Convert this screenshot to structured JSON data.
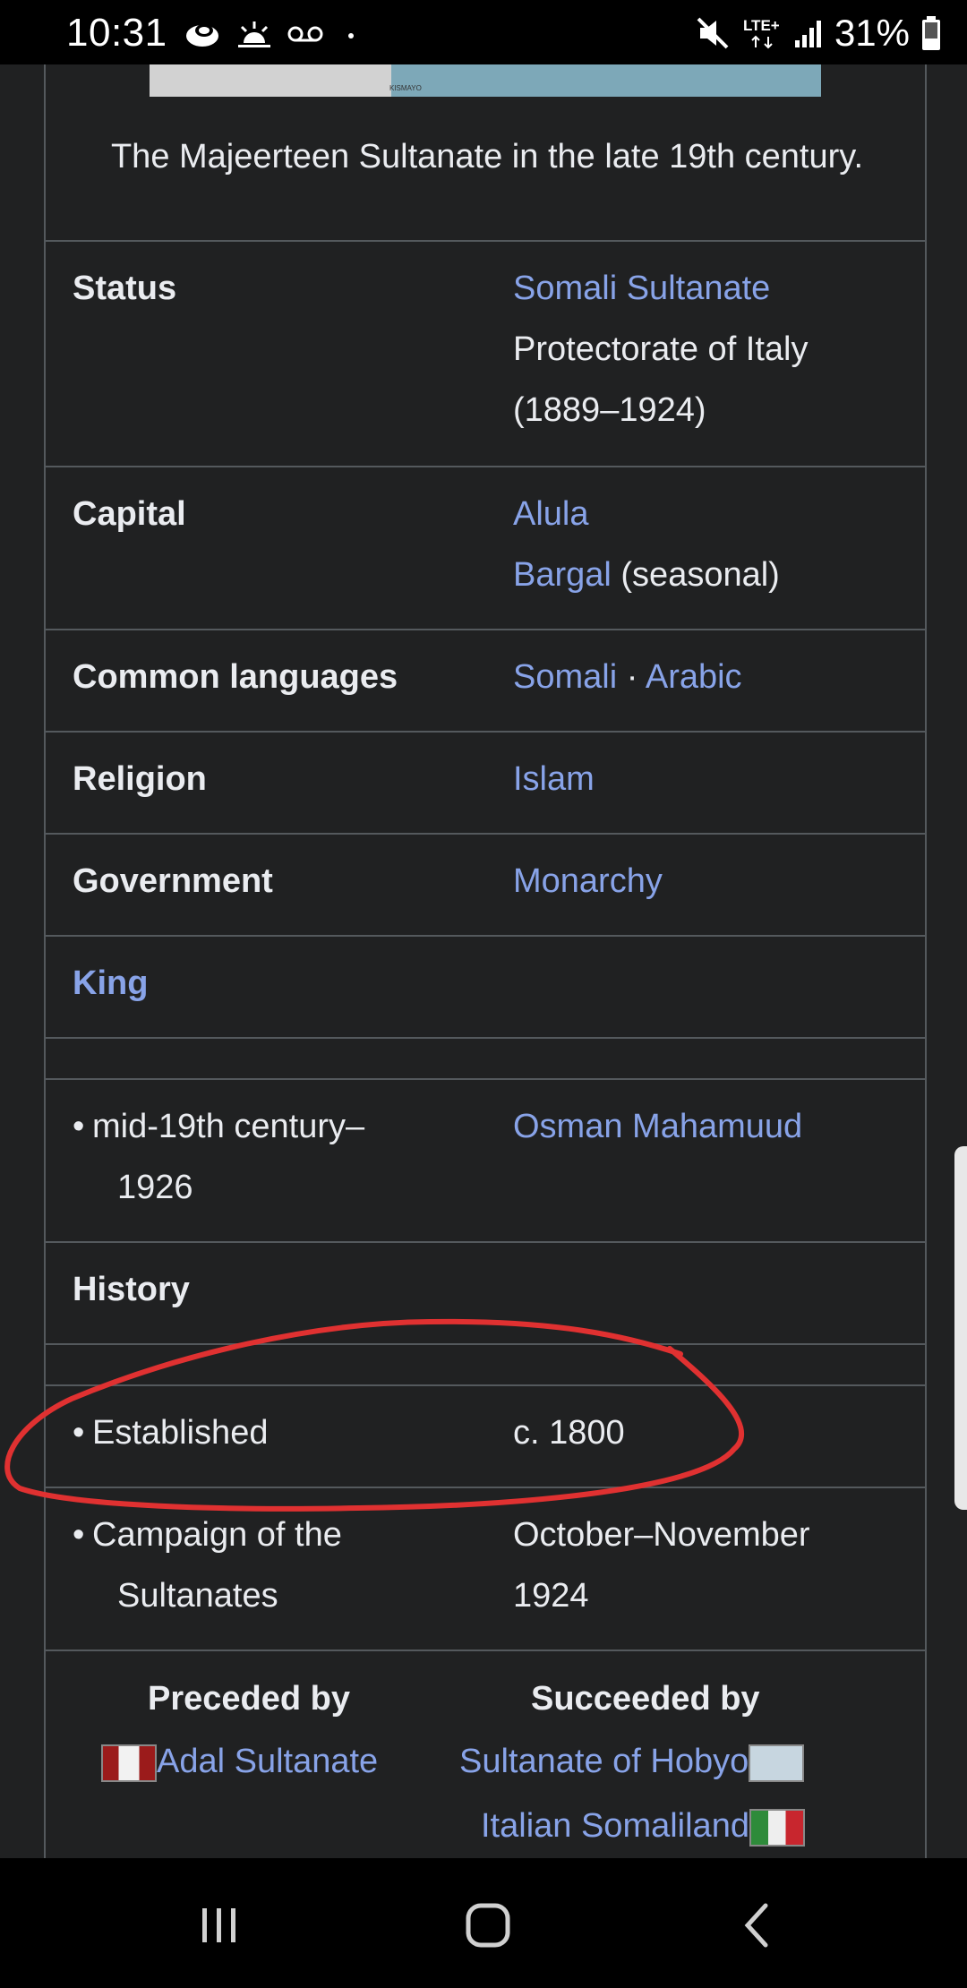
{
  "status_bar": {
    "time": "10:31",
    "left_icons": [
      "cloud-eye-icon",
      "sunrise-icon",
      "voicemail-icon",
      "dot-icon"
    ],
    "network": "LTE+",
    "battery": "31%"
  },
  "infobox": {
    "caption": "The Majeerteen Sultanate in the late 19th century.",
    "map_label": "KISMAYO",
    "rows": [
      {
        "label": "Status",
        "value_link": "Somali Sultanate",
        "value_text": "Protectorate of Italy (1889–1924)"
      },
      {
        "label": "Capital",
        "value_link_1": "Alula",
        "value_link_2": "Bargal",
        "value_text": "(seasonal)"
      },
      {
        "label": "Common languages",
        "value_link_1": "Somali",
        "separator": "·",
        "value_link_2": "Arabic"
      },
      {
        "label": "Religion",
        "value_link": "Islam"
      },
      {
        "label": "Government",
        "value_link": "Monarchy"
      },
      {
        "label": "King"
      },
      {
        "sub_label_1": "mid-19th century–",
        "sub_label_2": "1926",
        "value_link": "Osman Mahamuud"
      },
      {
        "label": "History"
      },
      {
        "sub_label_1": "Established",
        "value_text": "c. 1800"
      },
      {
        "sub_label_1": "Campaign of the",
        "sub_label_2": "Sultanates",
        "value_text_1": "October–November",
        "value_text_2": "1924"
      }
    ],
    "succession": {
      "preceded_by_label": "Preceded by",
      "succeeded_by_label": "Succeeded by",
      "preceded": "Adal Sultanate",
      "succeeded_1": "Sultanate of Hobyo",
      "succeeded_2": "Italian Somaliland"
    }
  },
  "annotation": {
    "color": "#e03131"
  },
  "nav_bar": {
    "buttons": [
      "recent-apps-icon",
      "home-icon",
      "back-icon"
    ]
  }
}
